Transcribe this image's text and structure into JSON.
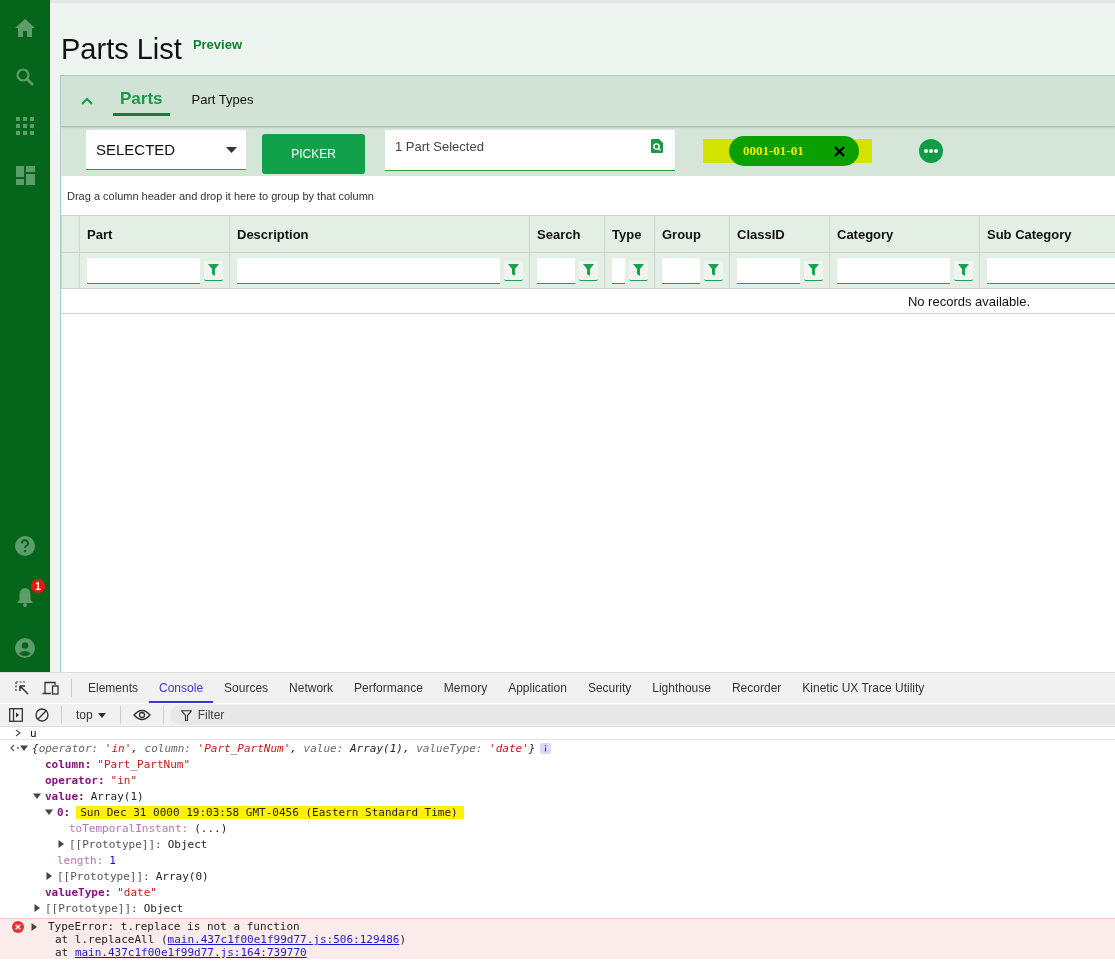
{
  "sidebar": {
    "notification_badge": "1"
  },
  "page": {
    "title": "Parts List",
    "badge": "Preview"
  },
  "panel": {
    "expanded": true,
    "tabs": [
      {
        "label": "Parts",
        "selected": true
      },
      {
        "label": "Part Types",
        "selected": false
      }
    ]
  },
  "toolbar": {
    "mode_select": {
      "value": "SELECTED"
    },
    "picker_button": "PICKER",
    "selection_field": {
      "value": "1 Part Selected"
    },
    "chips": [
      {
        "label": "0001-01-01",
        "highlighted": true
      }
    ]
  },
  "grid": {
    "group_hint": "Drag a column header and drop it here to group by that column",
    "columns": [
      {
        "label": "Part",
        "filter_button": true
      },
      {
        "label": "Description",
        "filter_button": true
      },
      {
        "label": "Search",
        "filter_button": true
      },
      {
        "label": "Type",
        "filter_button": true
      },
      {
        "label": "Group",
        "filter_button": true
      },
      {
        "label": "ClassID",
        "filter_button": true
      },
      {
        "label": "Category",
        "filter_button": true
      },
      {
        "label": "Sub Category",
        "filter_button": false
      }
    ],
    "empty_message": "No records available."
  },
  "devtools": {
    "tabs": [
      {
        "label": "Elements",
        "selected": false
      },
      {
        "label": "Console",
        "selected": true
      },
      {
        "label": "Sources",
        "selected": false
      },
      {
        "label": "Network",
        "selected": false
      },
      {
        "label": "Performance",
        "selected": false
      },
      {
        "label": "Memory",
        "selected": false
      },
      {
        "label": "Application",
        "selected": false
      },
      {
        "label": "Security",
        "selected": false
      },
      {
        "label": "Lighthouse",
        "selected": false
      },
      {
        "label": "Recorder",
        "selected": false
      },
      {
        "label": "Kinetic UX Trace Utility",
        "selected": false
      }
    ],
    "context": "top",
    "filter": {
      "placeholder": "Filter"
    },
    "console": {
      "input": "u",
      "result": {
        "expanded": true,
        "summary": [
          {
            "text": "{",
            "kind": "punct"
          },
          {
            "text": "operator: ",
            "kind": "key"
          },
          {
            "text": "'in'",
            "kind": "string"
          },
          {
            "text": ", ",
            "kind": "punct"
          },
          {
            "text": "column: ",
            "kind": "key"
          },
          {
            "text": "'Part_PartNum'",
            "kind": "string"
          },
          {
            "text": ", ",
            "kind": "punct"
          },
          {
            "text": "value: ",
            "kind": "key"
          },
          {
            "text": "Array(1)",
            "kind": "object"
          },
          {
            "text": ", ",
            "kind": "punct"
          },
          {
            "text": "valueType: ",
            "kind": "key"
          },
          {
            "text": "'date'",
            "kind": "string"
          },
          {
            "text": "}",
            "kind": "punct"
          }
        ],
        "children": [
          {
            "key": "column:",
            "kind": "own",
            "value": "\"Part_PartNum\"",
            "color": "#c41a16"
          },
          {
            "key": "operator:",
            "kind": "own",
            "value": "\"in\"",
            "color": "#c41a16"
          },
          {
            "key": "value:",
            "kind": "own",
            "value": "Array(1)",
            "color": "#222222",
            "expanded": true,
            "children": [
              {
                "key": "0:",
                "kind": "own",
                "value": "Sun Dec 31 0000 19:03:58 GMT-0456 (Eastern Standard Time)",
                "expanded": true,
                "highlighted": true,
                "children": [
                  {
                    "key": "toTemporalInstant:",
                    "kind": "hidden",
                    "value": "(...)",
                    "color": "#222222"
                  },
                  {
                    "key": "[[Prototype]]:",
                    "kind": "internal",
                    "value": "Object",
                    "color": "#222222",
                    "expanded": false
                  }
                ]
              },
              {
                "key": "length:",
                "kind": "hidden",
                "value": "1",
                "color": "#1c00cf"
              },
              {
                "key": "[[Prototype]]:",
                "kind": "internal",
                "value": "Array(0)",
                "color": "#222222",
                "expanded": false
              }
            ]
          },
          {
            "key": "valueType:",
            "kind": "own",
            "value": "\"date\"",
            "color": "#c41a16"
          },
          {
            "key": "[[Prototype]]:",
            "kind": "internal",
            "value": "Object",
            "color": "#222222",
            "expanded": false
          }
        ]
      },
      "error": {
        "message": "TypeError: t.replace is not a function",
        "expanded": false,
        "stack": [
          {
            "prefix": "at l.replaceAll (",
            "link": "main.437c1f00e1f99d77.js:506:129486",
            "suffix": ")"
          },
          {
            "prefix": "at ",
            "link": "main.437c1f00e1f99d77.js:164:739770"
          }
        ]
      }
    }
  }
}
